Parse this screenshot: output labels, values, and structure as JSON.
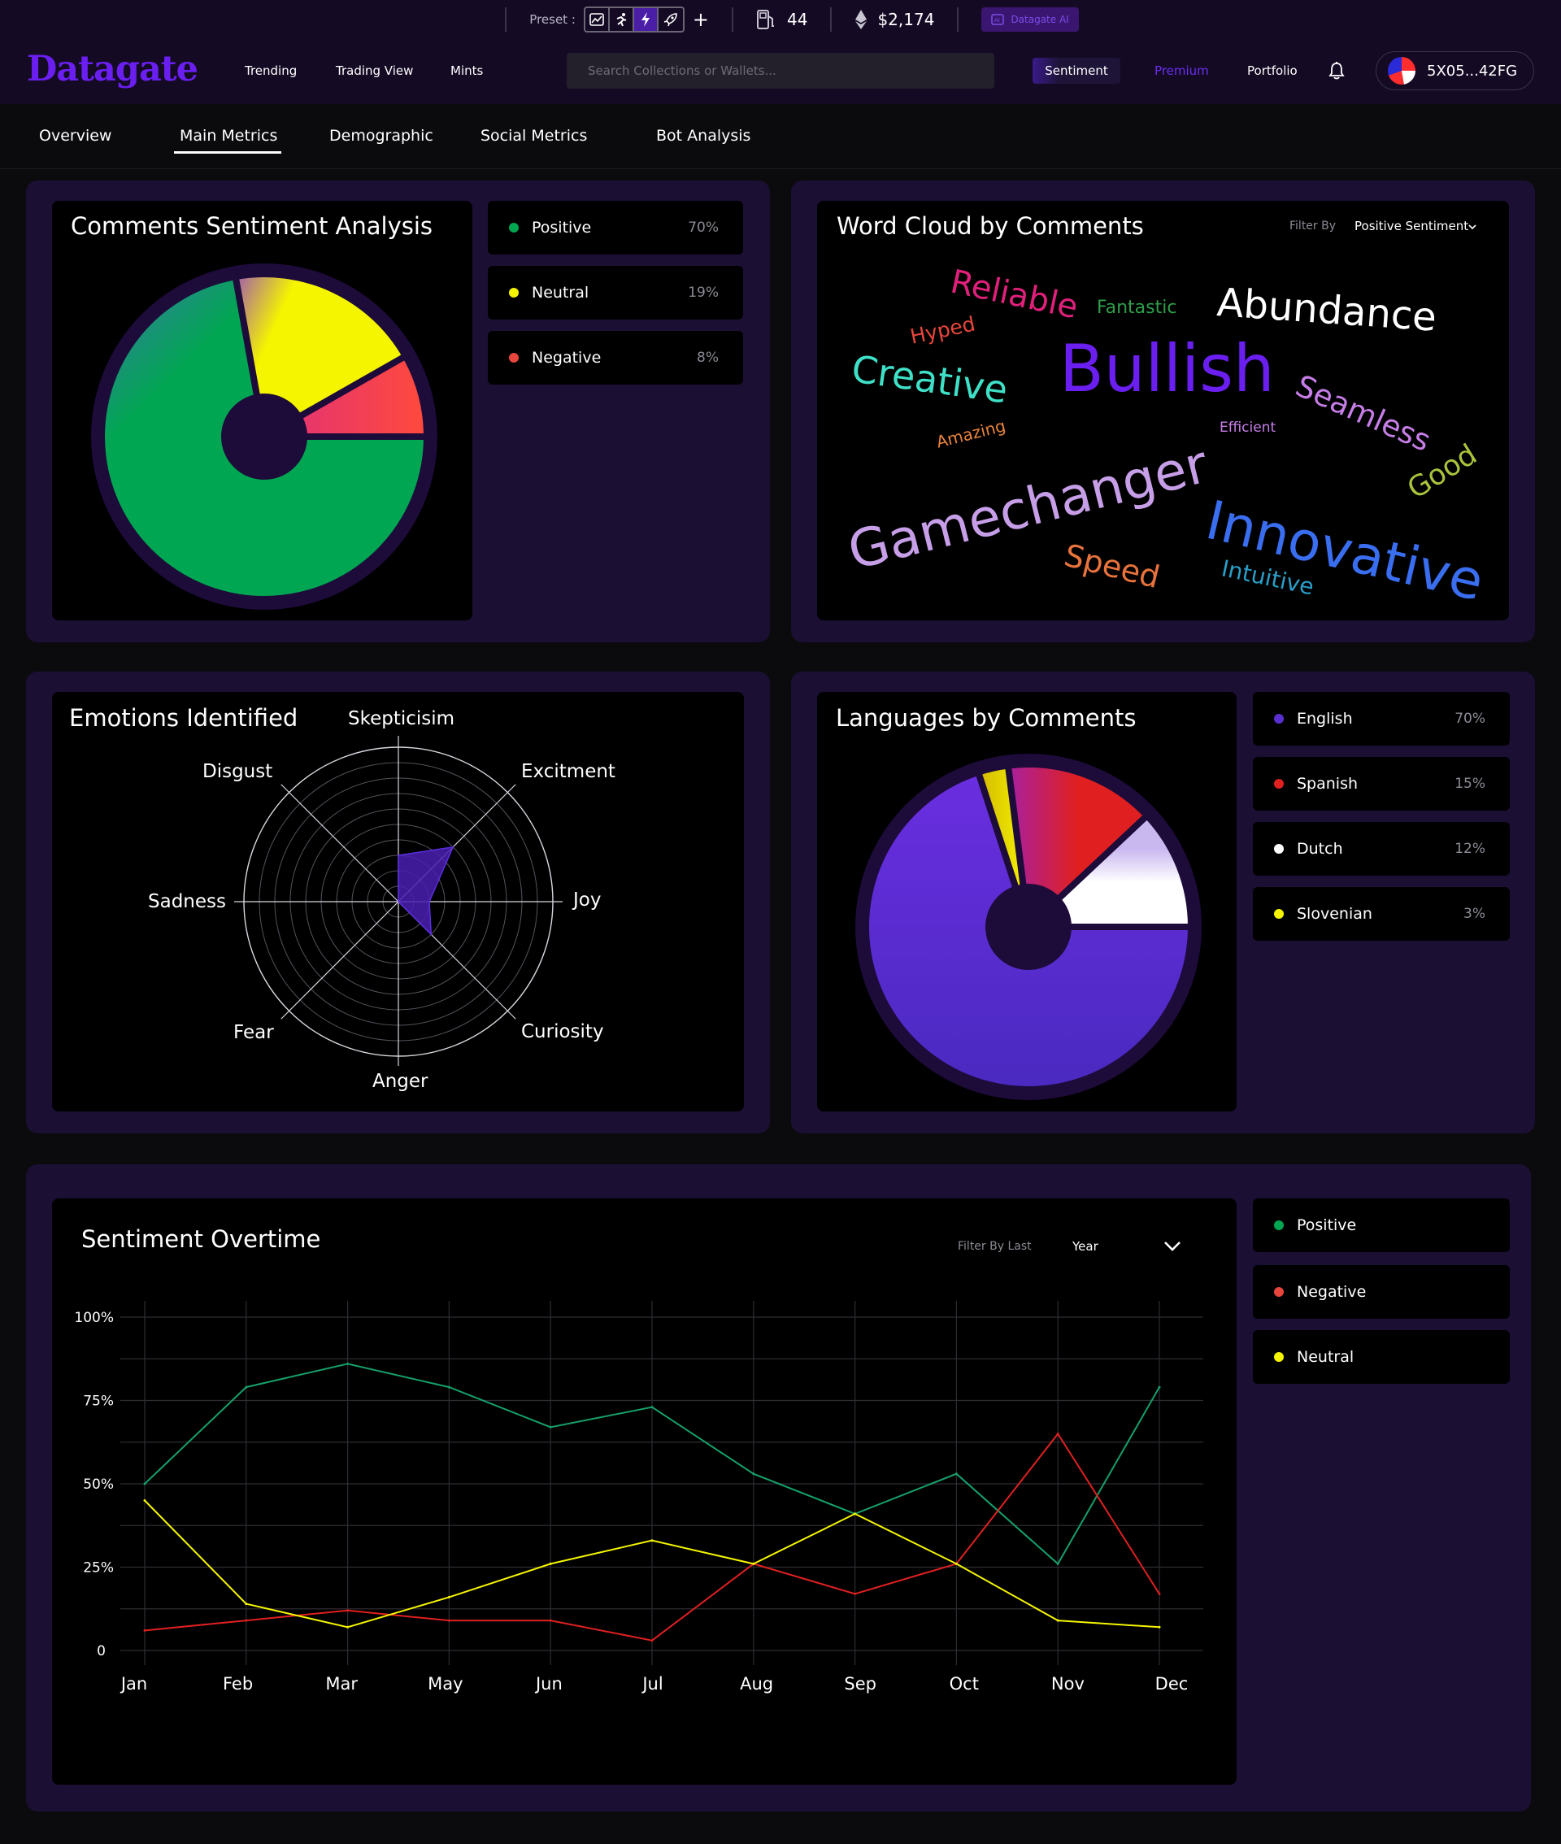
{
  "topbar": {
    "preset_label": "Preset :",
    "gas_value": "44",
    "eth_value": "$2,174",
    "ai_button": "Datagate AI",
    "add_preset": "+"
  },
  "nav": {
    "logo": "Datagate",
    "links": [
      "Trending",
      "Trading View",
      "Mints"
    ],
    "search_placeholder": "Search Collections or Wallets...",
    "sentiment": "Sentiment",
    "premium": "Premium",
    "portfolio": "Portfolio",
    "wallet": "5X05...42FG"
  },
  "tabs": [
    "Overview",
    "Main Metrics",
    "Demographic",
    "Social Metrics",
    "Bot Analysis"
  ],
  "sentiment_pie": {
    "title": "Comments Sentiment Analysis",
    "legend": [
      {
        "label": "Positive",
        "pct": "70%",
        "color": "#00a651"
      },
      {
        "label": "Neutral",
        "pct": "19%",
        "color": "#f5f500"
      },
      {
        "label": "Negative",
        "pct": "8%",
        "color": "#e8463c"
      }
    ]
  },
  "word_cloud": {
    "title": "Word Cloud by Comments",
    "filter_label": "Filter By",
    "filter_value": "Positive Sentiment",
    "words": [
      {
        "text": "Reliable",
        "color": "#e0207a"
      },
      {
        "text": "Fantastic",
        "color": "#2f9e4a"
      },
      {
        "text": "Abundance",
        "color": "#ffffff"
      },
      {
        "text": "Hyped",
        "color": "#e8463c"
      },
      {
        "text": "Bullish",
        "color": "#6a1ff0"
      },
      {
        "text": "Creative",
        "color": "#3fe0c8"
      },
      {
        "text": "Seamless",
        "color": "#c77ee8"
      },
      {
        "text": "Amazing",
        "color": "#e8833c"
      },
      {
        "text": "Efficient",
        "color": "#c77ee8"
      },
      {
        "text": "Good",
        "color": "#a9c43c"
      },
      {
        "text": "Gamechanger",
        "color": "#c79ee8"
      },
      {
        "text": "Innovative",
        "color": "#3a6ef0"
      },
      {
        "text": "Speed",
        "color": "#e8733c"
      },
      {
        "text": "Intuitive",
        "color": "#2a9ec8"
      }
    ]
  },
  "emotions": {
    "title": "Emotions Identified",
    "labels": [
      "Skepticisim",
      "Excitment",
      "Joy",
      "Curiosity",
      "Anger",
      "Fear",
      "Sadness",
      "Disgust"
    ]
  },
  "languages": {
    "title": "Languages by Comments",
    "legend": [
      {
        "label": "English",
        "pct": "70%",
        "color": "#5a2fd0"
      },
      {
        "label": "Spanish",
        "pct": "15%",
        "color": "#e02020"
      },
      {
        "label": "Dutch",
        "pct": "12%",
        "color": "#ffffff"
      },
      {
        "label": "Slovenian",
        "pct": "3%",
        "color": "#f5f500"
      }
    ]
  },
  "sentiment_time": {
    "title": "Sentiment Overtime",
    "filter_label": "Filter By Last",
    "filter_value": "Year",
    "legend": [
      {
        "label": "Positive",
        "color": "#00a651"
      },
      {
        "label": "Negative",
        "color": "#e8463c"
      },
      {
        "label": "Neutral",
        "color": "#f5f500"
      }
    ]
  },
  "chart_data": [
    {
      "type": "pie",
      "title": "Comments Sentiment Analysis",
      "labels": [
        "Positive",
        "Neutral",
        "Negative"
      ],
      "values": [
        70,
        19,
        8
      ],
      "colors": [
        "#00a651",
        "#f5f500",
        "#e8463c"
      ]
    },
    {
      "type": "pie",
      "title": "Languages by Comments",
      "labels": [
        "English",
        "Spanish",
        "Dutch",
        "Slovenian"
      ],
      "values": [
        70,
        15,
        12,
        3
      ],
      "colors": [
        "#5a2fd0",
        "#e02020",
        "#ffffff",
        "#f5f500"
      ]
    },
    {
      "type": "radar",
      "title": "Emotions Identified",
      "axes": [
        "Skepticisim",
        "Excitment",
        "Joy",
        "Curiosity",
        "Anger",
        "Fear",
        "Sadness",
        "Disgust"
      ],
      "values": [
        3,
        5,
        2,
        3,
        0,
        0,
        0,
        0
      ],
      "rmax": 10,
      "grid_rings": 10
    },
    {
      "type": "line",
      "title": "Sentiment Overtime",
      "categories": [
        "Jan",
        "Feb",
        "Mar",
        "May",
        "Jun",
        "Jul",
        "Aug",
        "Sep",
        "Oct",
        "Nov",
        "Dec"
      ],
      "yticks": [
        "0",
        "25%",
        "50%",
        "75%",
        "100%"
      ],
      "ylim": [
        0,
        100
      ],
      "grid": true,
      "series": [
        {
          "name": "Positive",
          "color": "#16a06a",
          "values": [
            50,
            79,
            86,
            79,
            67,
            73,
            53,
            41,
            53,
            26,
            79
          ]
        },
        {
          "name": "Negative",
          "color": "#e02020",
          "values": [
            6,
            9,
            12,
            9,
            9,
            3,
            26,
            17,
            26,
            65,
            17
          ]
        },
        {
          "name": "Neutral",
          "color": "#f5f500",
          "values": [
            45,
            14,
            7,
            16,
            26,
            33,
            26,
            41,
            26,
            9,
            7
          ]
        }
      ]
    }
  ]
}
